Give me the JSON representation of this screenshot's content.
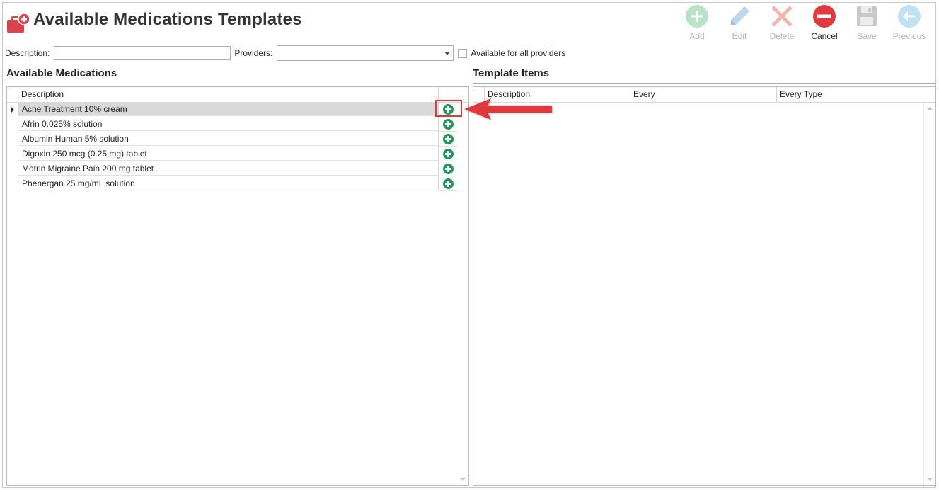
{
  "header": {
    "title": "Available Medications Templates"
  },
  "toolbar": {
    "add_label": "Add",
    "edit_label": "Edit",
    "delete_label": "Delete",
    "cancel_label": "Cancel",
    "save_label": "Save",
    "previous_label": "Previous"
  },
  "filters": {
    "description_label": "Description:",
    "description_value": "",
    "providers_label": "Providers:",
    "providers_value": "",
    "available_all_label": "Available for all providers",
    "available_all_checked": false
  },
  "available_medications": {
    "title": "Available Medications",
    "column_description": "Description",
    "rows": [
      {
        "label": "Acne Treatment 10% cream",
        "selected": true
      },
      {
        "label": "Afrin 0.025% solution",
        "selected": false
      },
      {
        "label": "Albumin Human 5% solution",
        "selected": false
      },
      {
        "label": "Digoxin 250 mcg (0.25 mg) tablet",
        "selected": false
      },
      {
        "label": "Motrin Migraine Pain 200 mg tablet",
        "selected": false
      },
      {
        "label": "Phenergan 25 mg/mL solution",
        "selected": false
      }
    ]
  },
  "template_items": {
    "title": "Template Items",
    "columns": [
      "Description",
      "Every",
      "Every Type"
    ],
    "rows": []
  },
  "colors": {
    "accent_green": "#1f9a59",
    "cancel_red": "#e0393e",
    "annotation_red": "#e0393e",
    "selected_row": "#d9d9d9",
    "section_line": "#9ab0c8"
  },
  "icons": {
    "title": "medical-bag-plus-icon",
    "add": "plus-circle-icon",
    "edit": "pencil-icon",
    "delete": "x-icon",
    "cancel": "no-entry-icon",
    "save": "floppy-disk-icon",
    "previous": "arrow-left-circle-icon",
    "row_add": "plus-circle-icon",
    "annotation": "arrow-left-icon"
  }
}
